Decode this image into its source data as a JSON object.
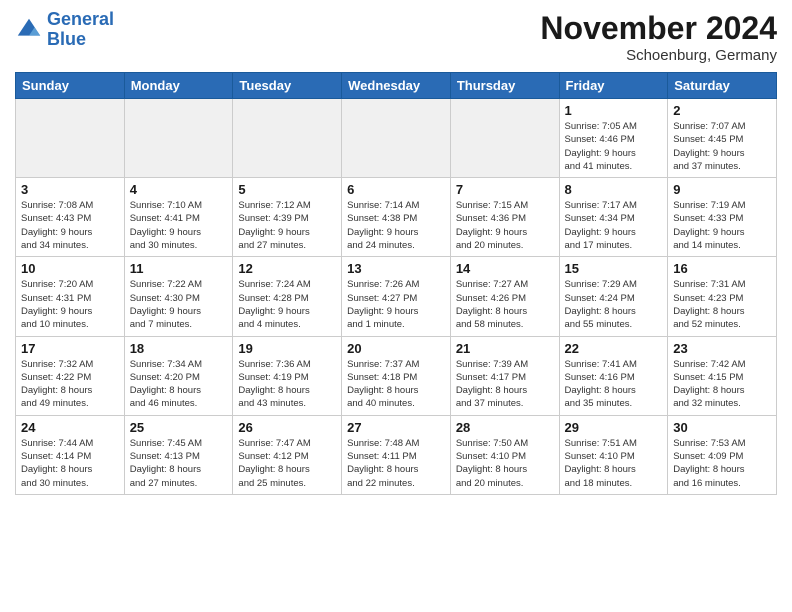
{
  "header": {
    "logo_general": "General",
    "logo_blue": "Blue",
    "month_title": "November 2024",
    "location": "Schoenburg, Germany"
  },
  "weekdays": [
    "Sunday",
    "Monday",
    "Tuesday",
    "Wednesday",
    "Thursday",
    "Friday",
    "Saturday"
  ],
  "weeks": [
    [
      {
        "day": "",
        "detail": ""
      },
      {
        "day": "",
        "detail": ""
      },
      {
        "day": "",
        "detail": ""
      },
      {
        "day": "",
        "detail": ""
      },
      {
        "day": "",
        "detail": ""
      },
      {
        "day": "1",
        "detail": "Sunrise: 7:05 AM\nSunset: 4:46 PM\nDaylight: 9 hours\nand 41 minutes."
      },
      {
        "day": "2",
        "detail": "Sunrise: 7:07 AM\nSunset: 4:45 PM\nDaylight: 9 hours\nand 37 minutes."
      }
    ],
    [
      {
        "day": "3",
        "detail": "Sunrise: 7:08 AM\nSunset: 4:43 PM\nDaylight: 9 hours\nand 34 minutes."
      },
      {
        "day": "4",
        "detail": "Sunrise: 7:10 AM\nSunset: 4:41 PM\nDaylight: 9 hours\nand 30 minutes."
      },
      {
        "day": "5",
        "detail": "Sunrise: 7:12 AM\nSunset: 4:39 PM\nDaylight: 9 hours\nand 27 minutes."
      },
      {
        "day": "6",
        "detail": "Sunrise: 7:14 AM\nSunset: 4:38 PM\nDaylight: 9 hours\nand 24 minutes."
      },
      {
        "day": "7",
        "detail": "Sunrise: 7:15 AM\nSunset: 4:36 PM\nDaylight: 9 hours\nand 20 minutes."
      },
      {
        "day": "8",
        "detail": "Sunrise: 7:17 AM\nSunset: 4:34 PM\nDaylight: 9 hours\nand 17 minutes."
      },
      {
        "day": "9",
        "detail": "Sunrise: 7:19 AM\nSunset: 4:33 PM\nDaylight: 9 hours\nand 14 minutes."
      }
    ],
    [
      {
        "day": "10",
        "detail": "Sunrise: 7:20 AM\nSunset: 4:31 PM\nDaylight: 9 hours\nand 10 minutes."
      },
      {
        "day": "11",
        "detail": "Sunrise: 7:22 AM\nSunset: 4:30 PM\nDaylight: 9 hours\nand 7 minutes."
      },
      {
        "day": "12",
        "detail": "Sunrise: 7:24 AM\nSunset: 4:28 PM\nDaylight: 9 hours\nand 4 minutes."
      },
      {
        "day": "13",
        "detail": "Sunrise: 7:26 AM\nSunset: 4:27 PM\nDaylight: 9 hours\nand 1 minute."
      },
      {
        "day": "14",
        "detail": "Sunrise: 7:27 AM\nSunset: 4:26 PM\nDaylight: 8 hours\nand 58 minutes."
      },
      {
        "day": "15",
        "detail": "Sunrise: 7:29 AM\nSunset: 4:24 PM\nDaylight: 8 hours\nand 55 minutes."
      },
      {
        "day": "16",
        "detail": "Sunrise: 7:31 AM\nSunset: 4:23 PM\nDaylight: 8 hours\nand 52 minutes."
      }
    ],
    [
      {
        "day": "17",
        "detail": "Sunrise: 7:32 AM\nSunset: 4:22 PM\nDaylight: 8 hours\nand 49 minutes."
      },
      {
        "day": "18",
        "detail": "Sunrise: 7:34 AM\nSunset: 4:20 PM\nDaylight: 8 hours\nand 46 minutes."
      },
      {
        "day": "19",
        "detail": "Sunrise: 7:36 AM\nSunset: 4:19 PM\nDaylight: 8 hours\nand 43 minutes."
      },
      {
        "day": "20",
        "detail": "Sunrise: 7:37 AM\nSunset: 4:18 PM\nDaylight: 8 hours\nand 40 minutes."
      },
      {
        "day": "21",
        "detail": "Sunrise: 7:39 AM\nSunset: 4:17 PM\nDaylight: 8 hours\nand 37 minutes."
      },
      {
        "day": "22",
        "detail": "Sunrise: 7:41 AM\nSunset: 4:16 PM\nDaylight: 8 hours\nand 35 minutes."
      },
      {
        "day": "23",
        "detail": "Sunrise: 7:42 AM\nSunset: 4:15 PM\nDaylight: 8 hours\nand 32 minutes."
      }
    ],
    [
      {
        "day": "24",
        "detail": "Sunrise: 7:44 AM\nSunset: 4:14 PM\nDaylight: 8 hours\nand 30 minutes."
      },
      {
        "day": "25",
        "detail": "Sunrise: 7:45 AM\nSunset: 4:13 PM\nDaylight: 8 hours\nand 27 minutes."
      },
      {
        "day": "26",
        "detail": "Sunrise: 7:47 AM\nSunset: 4:12 PM\nDaylight: 8 hours\nand 25 minutes."
      },
      {
        "day": "27",
        "detail": "Sunrise: 7:48 AM\nSunset: 4:11 PM\nDaylight: 8 hours\nand 22 minutes."
      },
      {
        "day": "28",
        "detail": "Sunrise: 7:50 AM\nSunset: 4:10 PM\nDaylight: 8 hours\nand 20 minutes."
      },
      {
        "day": "29",
        "detail": "Sunrise: 7:51 AM\nSunset: 4:10 PM\nDaylight: 8 hours\nand 18 minutes."
      },
      {
        "day": "30",
        "detail": "Sunrise: 7:53 AM\nSunset: 4:09 PM\nDaylight: 8 hours\nand 16 minutes."
      }
    ]
  ]
}
